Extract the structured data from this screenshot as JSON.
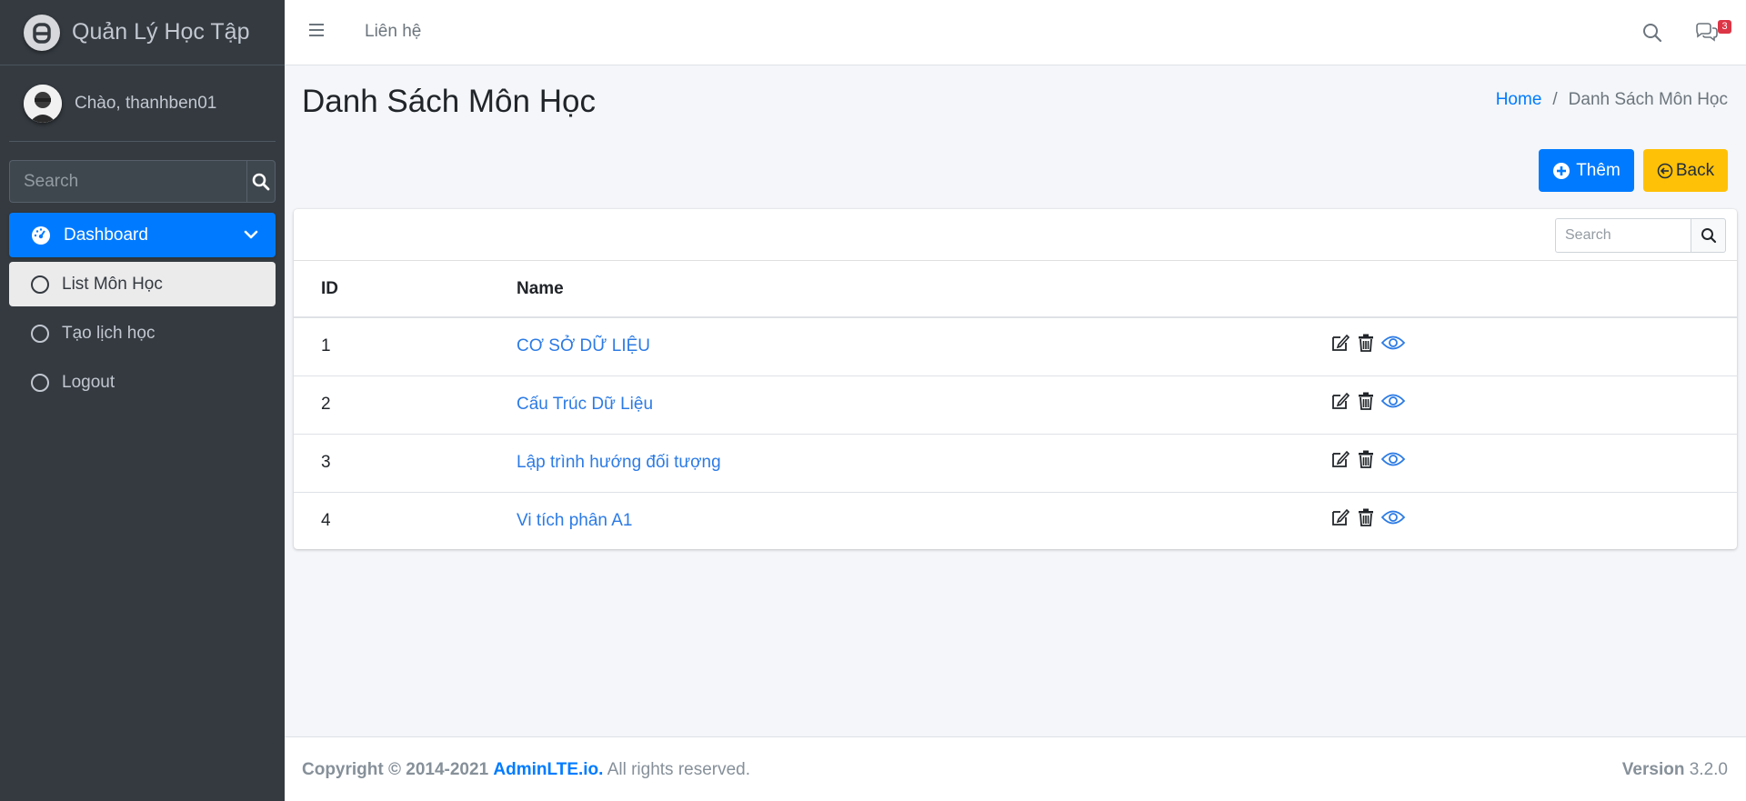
{
  "brand": {
    "title": "Quản Lý Học Tập"
  },
  "user": {
    "greeting": "Chào, thanhben01"
  },
  "sidebar": {
    "search_placeholder": "Search",
    "items": [
      {
        "label": "Dashboard",
        "icon": "dashboard-gauge-icon"
      },
      {
        "label": "List Môn Học",
        "icon": "circle-icon"
      },
      {
        "label": "Tạo lịch học",
        "icon": "circle-icon"
      },
      {
        "label": "Logout",
        "icon": "circle-icon"
      }
    ]
  },
  "topbar": {
    "contact": "Liên hệ",
    "notification_count": "3"
  },
  "page": {
    "title": "Danh Sách Môn Học"
  },
  "breadcrumb": {
    "home": "Home",
    "separator": "/",
    "current": "Danh Sách Môn Học"
  },
  "buttons": {
    "add": "Thêm",
    "back": "Back"
  },
  "table": {
    "search_placeholder": "Search",
    "headers": {
      "id": "ID",
      "name": "Name"
    },
    "rows": [
      {
        "id": "1",
        "name": "CƠ SỞ DỮ LIỆU"
      },
      {
        "id": "2",
        "name": "Cấu Trúc Dữ Liệu"
      },
      {
        "id": "3",
        "name": "Lập trình hướng đối tượng"
      },
      {
        "id": "4",
        "name": "Vi tích phân A1"
      }
    ]
  },
  "footer": {
    "copyright": "Copyright © 2014-2021",
    "link": "AdminLTE.io.",
    "rights": "All rights reserved.",
    "version_label": "Version",
    "version": "3.2.0"
  },
  "colors": {
    "primary": "#007bff",
    "warning": "#ffc107",
    "sidebar": "#343a40",
    "danger": "#dc3545"
  }
}
